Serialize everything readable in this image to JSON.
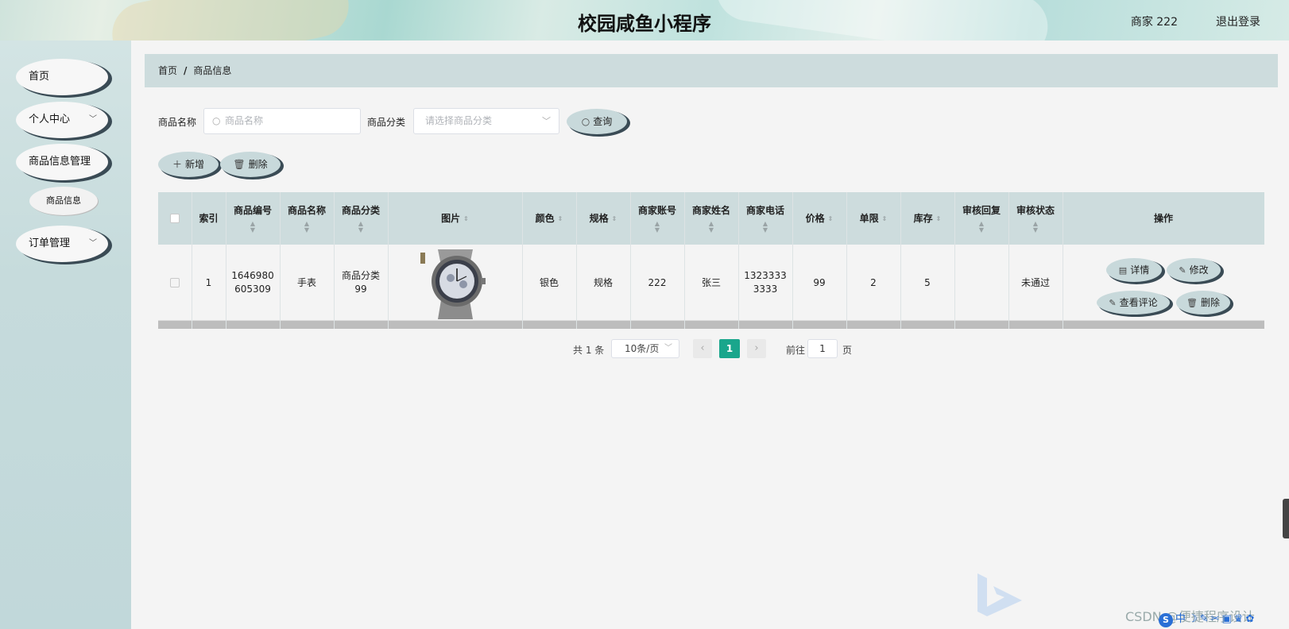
{
  "header": {
    "title": "校园咸鱼小程序",
    "user": "商家 222",
    "logout": "退出登录"
  },
  "sidebar": {
    "items": [
      {
        "label": "首页"
      },
      {
        "label": "个人中心"
      },
      {
        "label": "商品信息管理"
      },
      {
        "label": "商品信息"
      },
      {
        "label": "订单管理"
      }
    ]
  },
  "breadcrumb": {
    "home": "首页",
    "separator": "/",
    "current": "商品信息"
  },
  "search": {
    "name_label": "商品名称",
    "name_placeholder": "商品名称",
    "category_label": "商品分类",
    "category_placeholder": "请选择商品分类",
    "query_button": "查询"
  },
  "toolbar": {
    "add_button": "新增",
    "delete_button": "删除"
  },
  "table": {
    "headers": {
      "index": "索引",
      "code": "商品编号",
      "name": "商品名称",
      "category": "商品分类",
      "image": "图片",
      "color": "颜色",
      "spec": "规格",
      "merchant_account": "商家账号",
      "merchant_name": "商家姓名",
      "merchant_phone": "商家电话",
      "price": "价格",
      "limit": "单限",
      "stock": "库存",
      "audit_reply": "审核回复",
      "audit_status": "审核状态",
      "actions": "操作"
    },
    "rows": [
      {
        "index": "1",
        "code_line1": "1646980",
        "code_line2": "605309",
        "name": "手表",
        "category_line1": "商品分类",
        "category_line2": "99",
        "image_icon": "wristwatch-image",
        "color": "银色",
        "spec": "规格",
        "merchant_account": "222",
        "merchant_name": "张三",
        "phone_line1": "1323333",
        "phone_line2": "3333",
        "price": "99",
        "limit": "2",
        "stock": "5",
        "audit_reply": "",
        "audit_status": "未通过",
        "actions": {
          "detail": "详情",
          "edit": "修改",
          "reviews": "查看评论",
          "delete": "删除"
        }
      }
    ]
  },
  "pagination": {
    "total": "共 1 条",
    "page_size": "10条/页",
    "current_page": "1",
    "goto_label": "前往",
    "goto_value": "1",
    "page_suffix": "页"
  },
  "watermark": "CSDN @便捷程序设计",
  "colors": {
    "accent": "#1aa68c",
    "header_bg": "#cddcdd",
    "button_bg": "#c8d9db",
    "button_shadow": "#3a4b55"
  }
}
